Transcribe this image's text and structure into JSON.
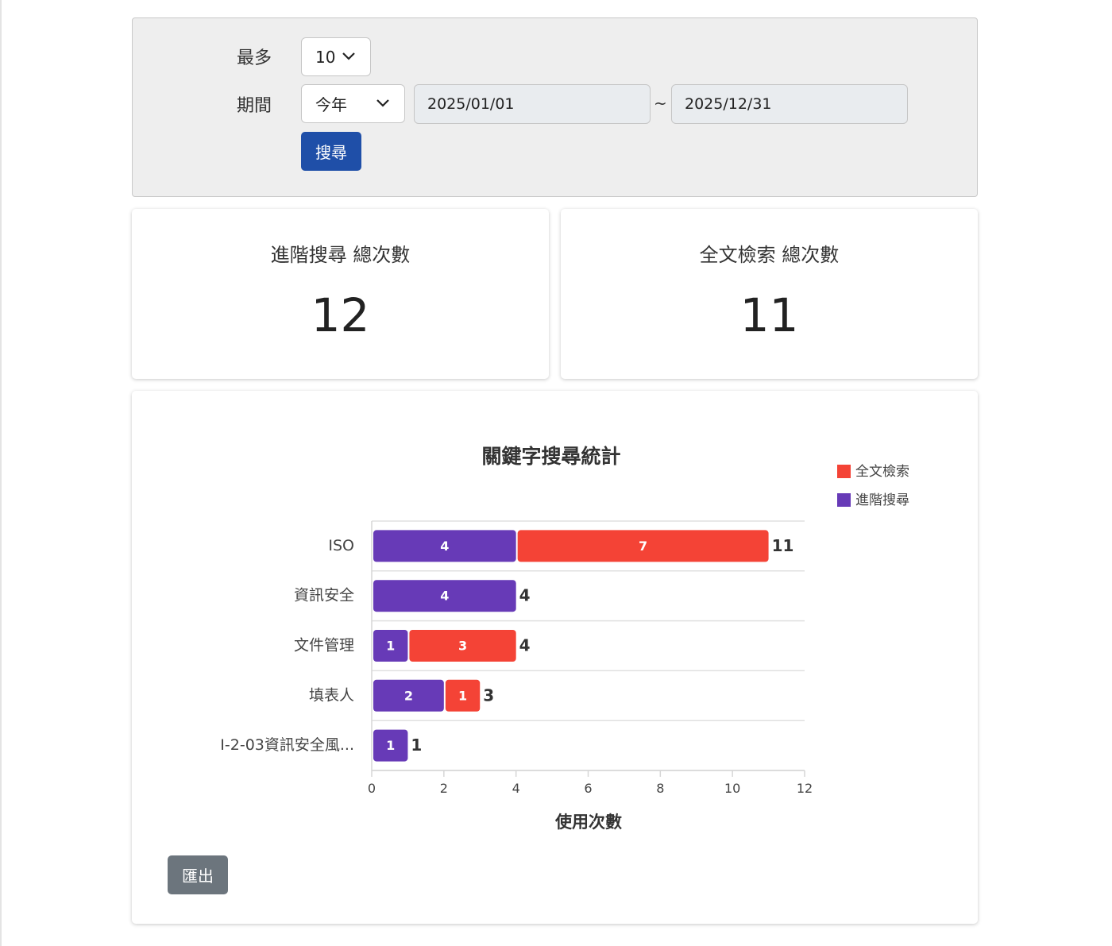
{
  "filter": {
    "max_label": "最多",
    "max_value": "10",
    "period_label": "期間",
    "period_value": "今年",
    "start_date": "2025/01/01",
    "separator": "~",
    "end_date": "2025/12/31",
    "search_button": "搜尋"
  },
  "stats": [
    {
      "title": "進階搜尋 總次數",
      "value": "12"
    },
    {
      "title": "全文檢索 總次數",
      "value": "11"
    }
  ],
  "export_button": "匯出",
  "colors": {
    "advanced": "#673ab7",
    "fulltext": "#f44336"
  },
  "chart_data": {
    "type": "bar",
    "orientation": "horizontal",
    "stacked": true,
    "title": "關鍵字搜尋統計",
    "xlabel": "使用次數",
    "ylabel": "",
    "categories": [
      "ISO",
      "資訊安全",
      "文件管理",
      "填表人",
      "I-2-03資訊安全風..."
    ],
    "series": [
      {
        "name": "進階搜尋",
        "color": "#673ab7",
        "values": [
          4,
          4,
          1,
          2,
          1
        ]
      },
      {
        "name": "全文檢索",
        "color": "#f44336",
        "values": [
          7,
          0,
          3,
          1,
          0
        ]
      }
    ],
    "totals": [
      11,
      4,
      4,
      3,
      1
    ],
    "xlim": [
      0,
      12
    ],
    "xticks": [
      0,
      2,
      4,
      6,
      8,
      10,
      12
    ],
    "legend_order": [
      "全文檢索",
      "進階搜尋"
    ],
    "legend_position": "top-right",
    "grid": "horizontal"
  }
}
